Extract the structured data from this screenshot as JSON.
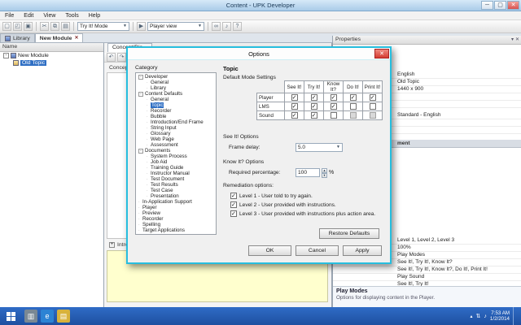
{
  "window": {
    "title": "Content - UPK Developer"
  },
  "menubar": {
    "items": [
      "File",
      "Edit",
      "View",
      "Tools",
      "Help"
    ]
  },
  "toolbar": {
    "mode_combo": "Try It! Mode",
    "view_combo": "Player view"
  },
  "doc_tabs": {
    "library": "Library",
    "module": "New Module"
  },
  "explorer": {
    "header": "Name",
    "root": "New Module",
    "child": "Old Topic"
  },
  "content": {
    "tab": "Concept/Dis...",
    "concept": "Concept",
    "introduction": "Introduction"
  },
  "properties": {
    "title": "Properties",
    "top_values": {
      "language": "English",
      "name": "Old Topic",
      "size": "1440 x 900",
      "template": "Standard - English"
    },
    "section_fragment": "ment",
    "list_values": [
      "Level 1, Level 2, Level 3",
      "100%",
      "Play Modes",
      "See It!, Try It!, Know It?",
      "See It!, Try It!, Know It?, Do It!, Print It!",
      "Play Sound",
      "See It!, Try It!"
    ],
    "footer_title": "Play Modes",
    "footer_desc": "Options for displaying content in the Player."
  },
  "dialog": {
    "title": "Options",
    "category_label": "Category",
    "categories": [
      {
        "label": "Developer",
        "level": 0,
        "expander": "-"
      },
      {
        "label": "General",
        "level": 1
      },
      {
        "label": "Library",
        "level": 1
      },
      {
        "label": "Content Defaults",
        "level": 0,
        "expander": "-"
      },
      {
        "label": "General",
        "level": 1
      },
      {
        "label": "Topic",
        "level": 1,
        "selected": true
      },
      {
        "label": "Recorder",
        "level": 1
      },
      {
        "label": "Bubble",
        "level": 1
      },
      {
        "label": "Introduction/End Frame",
        "level": 1
      },
      {
        "label": "String Input",
        "level": 1
      },
      {
        "label": "Glossary",
        "level": 1
      },
      {
        "label": "Web Page",
        "level": 1
      },
      {
        "label": "Assessment",
        "level": 1
      },
      {
        "label": "Documents",
        "level": 0,
        "expander": "-"
      },
      {
        "label": "System Process",
        "level": 1
      },
      {
        "label": "Job Aid",
        "level": 1
      },
      {
        "label": "Training Guide",
        "level": 1
      },
      {
        "label": "Instructor Manual",
        "level": 1
      },
      {
        "label": "Test Document",
        "level": 1
      },
      {
        "label": "Test Results",
        "level": 1
      },
      {
        "label": "Test Case",
        "level": 1
      },
      {
        "label": "Presentation",
        "level": 1
      },
      {
        "label": "In-Application Support",
        "level": 0
      },
      {
        "label": "Player",
        "level": 0
      },
      {
        "label": "Preview",
        "level": 0
      },
      {
        "label": "Recorder",
        "level": 0
      },
      {
        "label": "Spelling",
        "level": 0
      },
      {
        "label": "Target Applications",
        "level": 0
      }
    ],
    "panel": {
      "heading": "Topic",
      "default_mode_label": "Default Mode Settings",
      "mode_columns": [
        "See It!",
        "Try It!",
        "Know It?",
        "Do It!",
        "Print It!"
      ],
      "mode_rows": [
        {
          "label": "Player",
          "states": [
            "checked",
            "checked",
            "checked",
            "checked",
            "checked"
          ]
        },
        {
          "label": "LMS",
          "states": [
            "checked",
            "checked",
            "checked",
            "unchecked",
            "unchecked"
          ]
        },
        {
          "label": "Sound",
          "states": [
            "checked",
            "checked",
            "unchecked",
            "disabled",
            "disabled"
          ]
        }
      ],
      "see_it_label": "See It! Options",
      "frame_delay_label": "Frame delay:",
      "frame_delay_value": "5.0",
      "know_it_label": "Know It? Options",
      "required_pct_label": "Required percentage:",
      "required_pct_value": "100",
      "pct_suffix": "%",
      "remediation_label": "Remediation options:",
      "remediation": [
        {
          "checked": true,
          "label": "Level 1 - User told to try again."
        },
        {
          "checked": true,
          "label": "Level 2 - User provided with instructions."
        },
        {
          "checked": true,
          "label": "Level 3 - User provided with instructions plus action area."
        }
      ],
      "restore_button": "Restore Defaults"
    },
    "buttons": {
      "ok": "OK",
      "cancel": "Cancel",
      "apply": "Apply"
    }
  },
  "taskbar": {
    "time": "7:53 AM",
    "date": "1/2/2014"
  }
}
